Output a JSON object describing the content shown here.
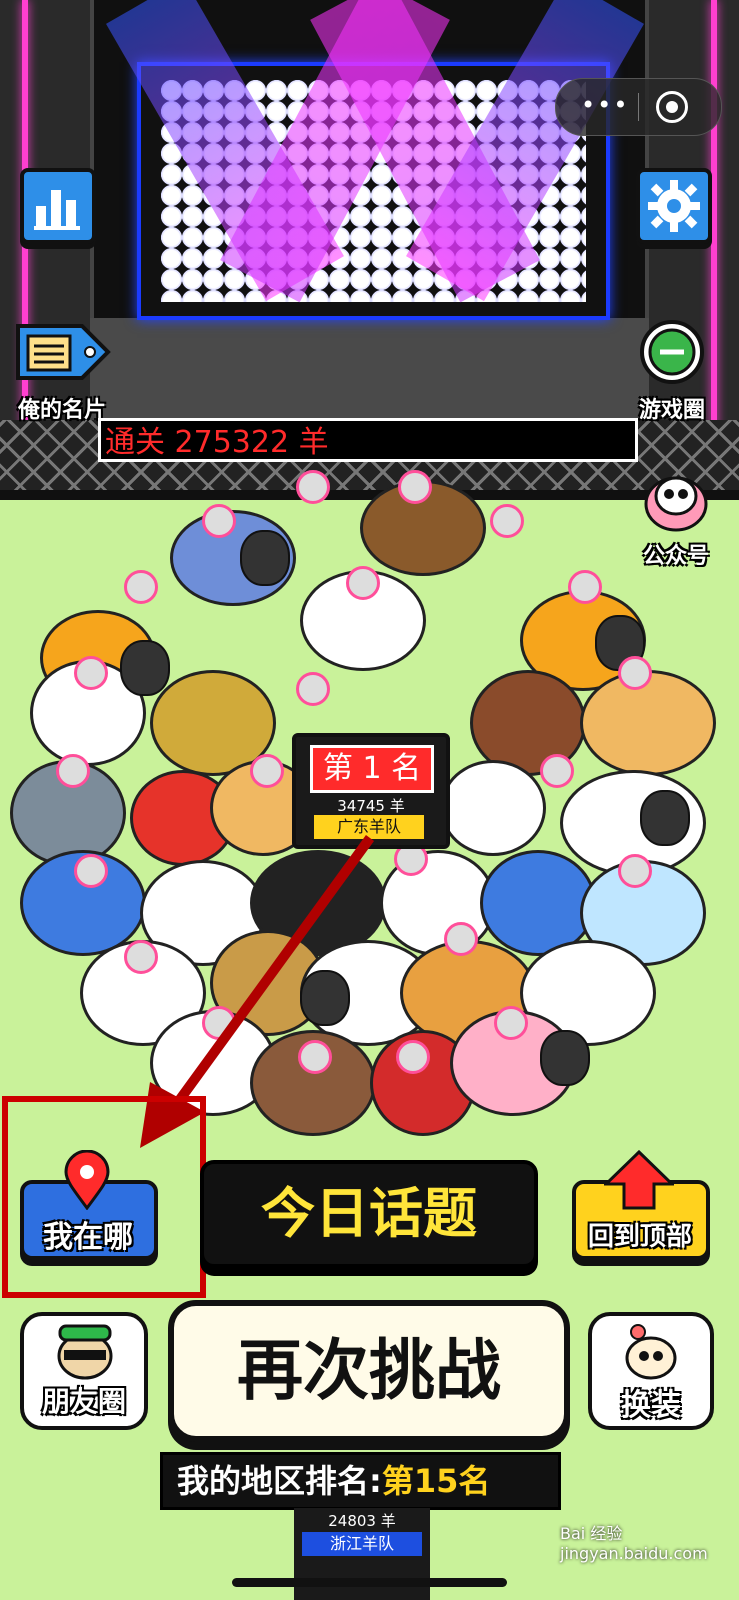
{
  "header": {
    "marquee_text": "通关 275322 羊",
    "menu_more_icon": "more-dots-icon",
    "menu_close_icon": "target-close-icon"
  },
  "left_buttons": {
    "leaderboard_icon": "bar-chart-icon",
    "card_label": "俺的名片"
  },
  "right_buttons": {
    "settings_icon": "gear-icon",
    "game_circle_label": "游戏圈",
    "official_label": "公众号"
  },
  "rank_sign": {
    "title": "第 1 名",
    "count": "34745 羊",
    "team": "广东羊队"
  },
  "bottom": {
    "where_label": "我在哪",
    "top_label": "回到顶部",
    "topic_label": "今日话题",
    "retry_label": "再次挑战",
    "moments_label": "朋友圈",
    "dress_label": "换装",
    "region_rank_prefix": "我的地区排名:",
    "region_rank_value": "第15名",
    "second_count": "24803 羊",
    "second_team": "浙江羊队",
    "watermark": "Bai 经验 jingyan.baidu.com"
  },
  "colors": {
    "grass": "#c9f29a",
    "accent_red": "#ff2b2b",
    "accent_yellow": "#ffd21e",
    "button_blue": "#2e8fe8",
    "annotation_red": "#c00000"
  }
}
